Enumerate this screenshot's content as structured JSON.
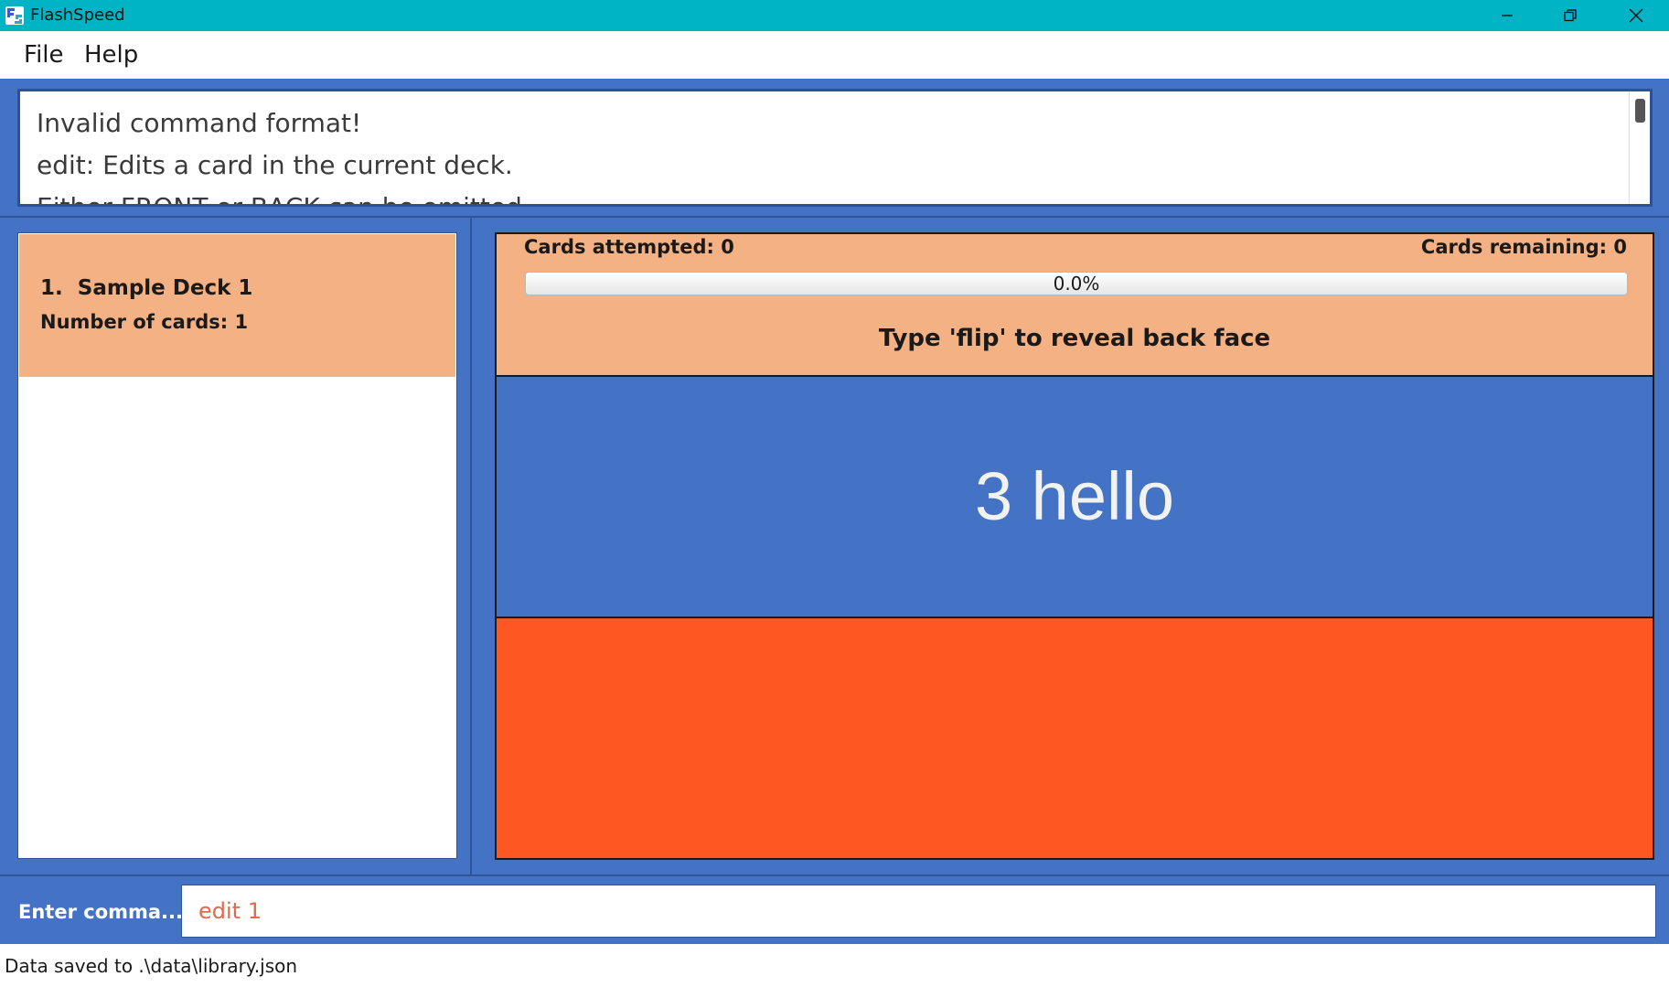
{
  "window": {
    "title": "FlashSpeed",
    "icon": "flashspeed-app-icon",
    "controls": [
      "minimize-icon",
      "restore-icon",
      "close-icon"
    ]
  },
  "menu": {
    "file_label": "File",
    "help_label": "Help"
  },
  "result_display": {
    "line1": "Invalid command format!",
    "line2": "edit: Edits a card in the current deck.",
    "line3": "Either FRONT or BACK can be omitted."
  },
  "deck_list": {
    "items": [
      {
        "index": "1.",
        "name": "Sample Deck 1",
        "card_count_label": "Number of cards: 1"
      }
    ]
  },
  "study": {
    "attempted_label": "Cards attempted: 0",
    "remaining_label": "Cards remaining: 0",
    "progress_fraction": 0.0,
    "progress_text": "0.0%",
    "flip_hint": "Type 'flip' to reveal back face",
    "front_text": "3 hello",
    "back_text": ""
  },
  "command": {
    "label": "Enter comma...",
    "value": "edit 1"
  },
  "status": {
    "text": "Data saved to .\\data\\library.json"
  },
  "colors": {
    "title_bar": "#00b4c5",
    "frame_blue": "#4472c4",
    "deck_card": "#f4b183",
    "back_face": "#ff5722",
    "command_text": "#e06a4c"
  }
}
